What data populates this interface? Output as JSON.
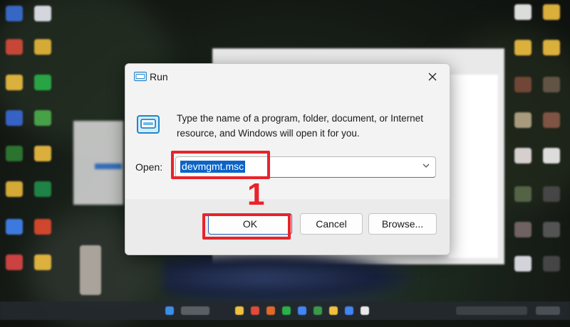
{
  "dialog": {
    "title": "Run",
    "description": "Type the name of a program, folder, document, or Internet resource, and Windows will open it for you.",
    "open_label": "Open:",
    "open_value": "devmgmt.msc",
    "buttons": {
      "ok": "OK",
      "cancel": "Cancel",
      "browse": "Browse..."
    },
    "close_icon": "close-icon",
    "run_icon": "run-icon"
  },
  "annotation": {
    "step_number": "1",
    "highlight_color": "#e8232b"
  },
  "colors": {
    "accent": "#0a64c8",
    "dialog_bg": "#f3f3f3"
  }
}
